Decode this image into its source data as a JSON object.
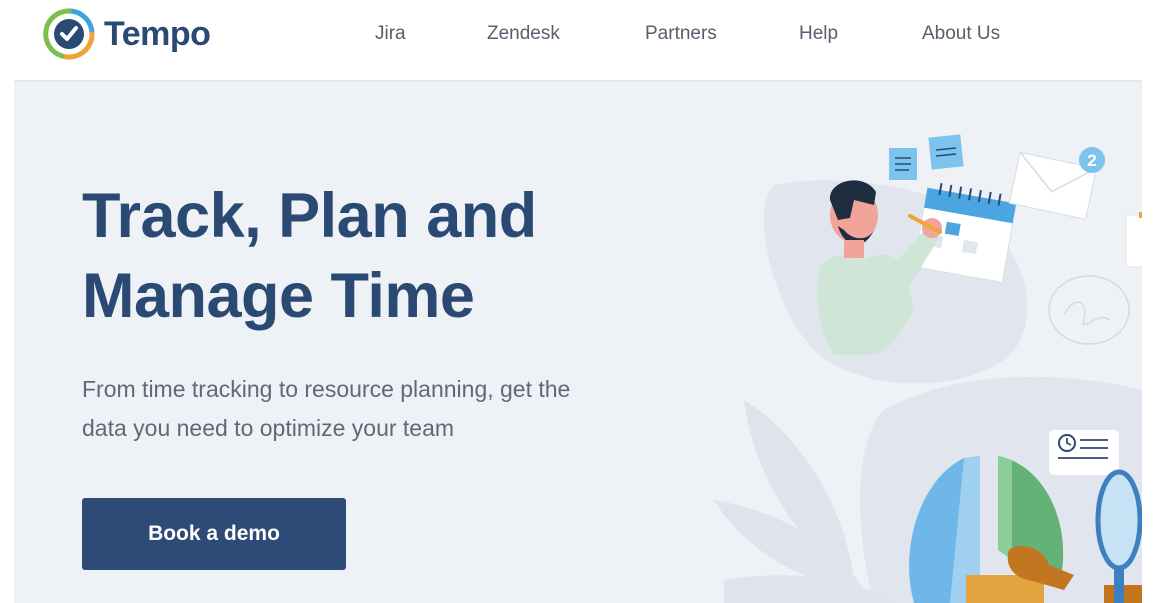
{
  "brand": {
    "name": "Tempo"
  },
  "nav": {
    "items": [
      {
        "label": "Jira"
      },
      {
        "label": "Zendesk"
      },
      {
        "label": "Partners"
      },
      {
        "label": "Help"
      },
      {
        "label": "About Us"
      }
    ]
  },
  "hero": {
    "title_line1": "Track, Plan and",
    "title_line2": "Manage Time",
    "subtitle_line1": "From time tracking to resource planning, get the",
    "subtitle_line2": "data you need to optimize your team",
    "cta_label": "Book a demo"
  },
  "illustration": {
    "notification_count": "2",
    "icons": [
      "checkmark-logo-icon",
      "envelope-icon",
      "calendar-icon",
      "clock-icon",
      "magnifier-icon",
      "sticky-note-icon"
    ]
  },
  "colors": {
    "brand_navy": "#2b4a73",
    "cta_background": "#2d4b76",
    "hero_background": "#eef1f6",
    "logo_blue": "#3ea4dc",
    "logo_green": "#7cbf4e",
    "logo_orange": "#f0a33a"
  }
}
